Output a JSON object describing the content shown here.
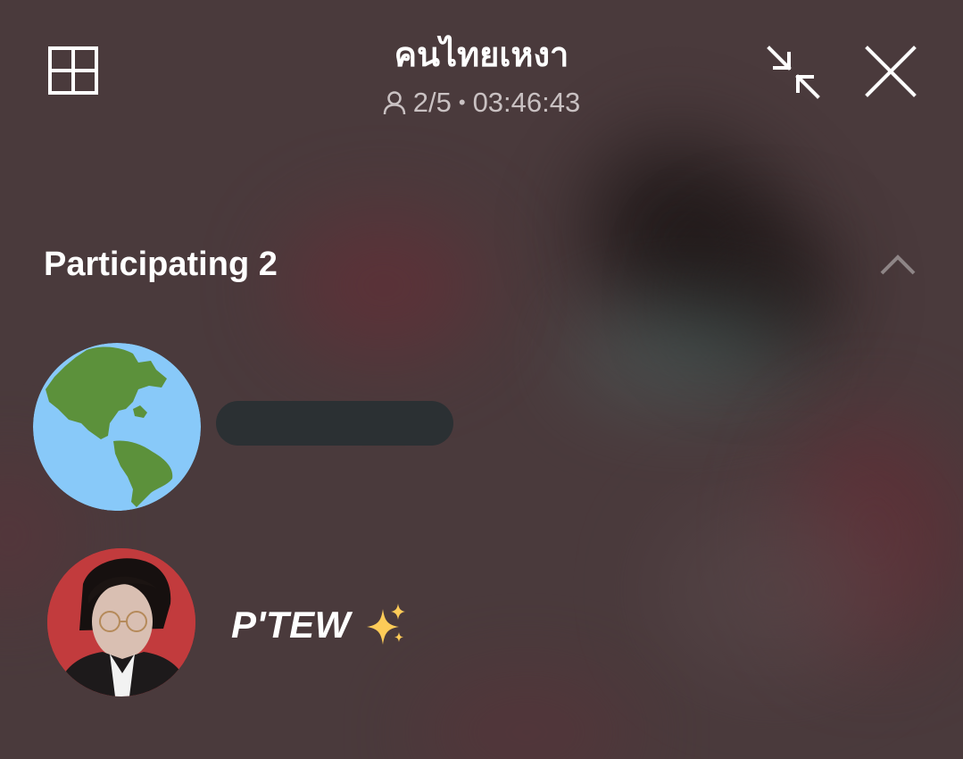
{
  "header": {
    "title": "คนไทยเหงา",
    "participants_count": "2/5",
    "separator": "•",
    "elapsed_time": "03:46:43",
    "icons": [
      "grid-icon",
      "minimize-icon",
      "close-icon",
      "person-icon"
    ]
  },
  "section": {
    "title": "Participating 2",
    "collapse_icon": "chevron-up-icon"
  },
  "participants": [
    {
      "name": "",
      "avatar": "globe-americas-emoji",
      "name_hidden": true
    },
    {
      "name": "P'TEW",
      "avatar": "profile-photo",
      "badge": "sparkles-emoji"
    }
  ],
  "colors": {
    "background": "#4a3a3c",
    "text_primary": "#ffffff",
    "text_secondary": "#c9c1c2",
    "placeholder": "#2b3033",
    "globe_ocean": "#88c9f9",
    "globe_land": "#5c913b",
    "sparkle": "#fdcb58"
  }
}
